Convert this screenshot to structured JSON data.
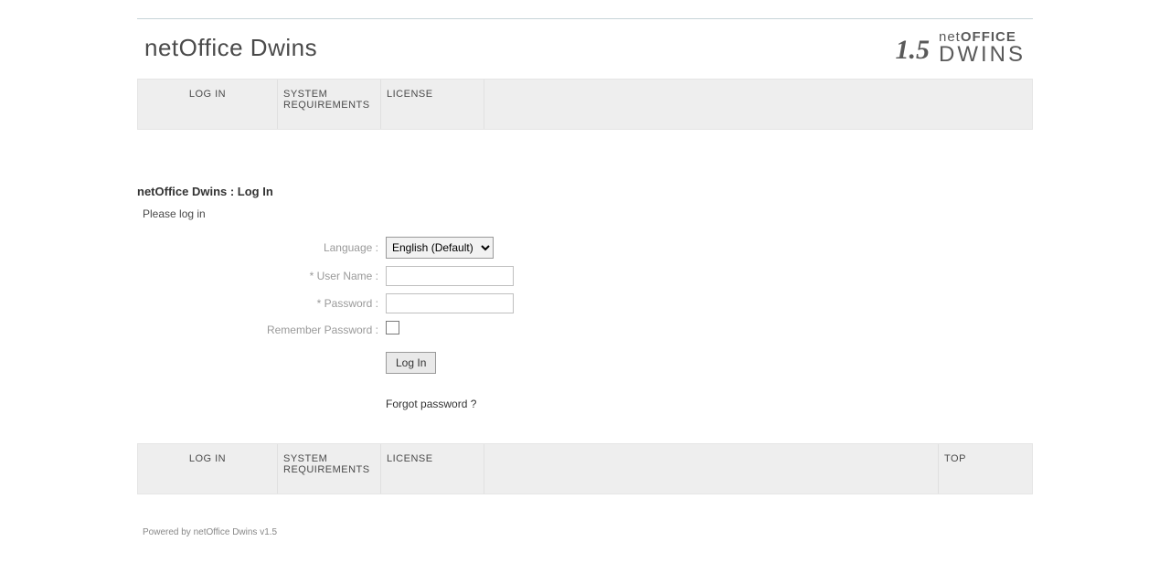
{
  "header": {
    "brand_left": "netOffice Dwins",
    "version": "1.5",
    "brand_top_thin": "net",
    "brand_top_bold": "OFFICE",
    "brand_bottom": "DWINS"
  },
  "nav": {
    "login": "LOG IN",
    "sysreq": "SYSTEM REQUIREMENTS",
    "license": "LICENSE",
    "top": "TOP"
  },
  "main": {
    "title": "netOffice Dwins : Log In",
    "please": "Please log in",
    "labels": {
      "language": "Language :",
      "username": "* User Name :",
      "password": "* Password :",
      "remember": "Remember Password :"
    },
    "language_value": "English (Default)",
    "username_value": "",
    "password_value": "",
    "login_button": "Log In",
    "forgot": "Forgot password ?"
  },
  "footer": {
    "powered": "Powered by netOffice Dwins v1.5"
  }
}
